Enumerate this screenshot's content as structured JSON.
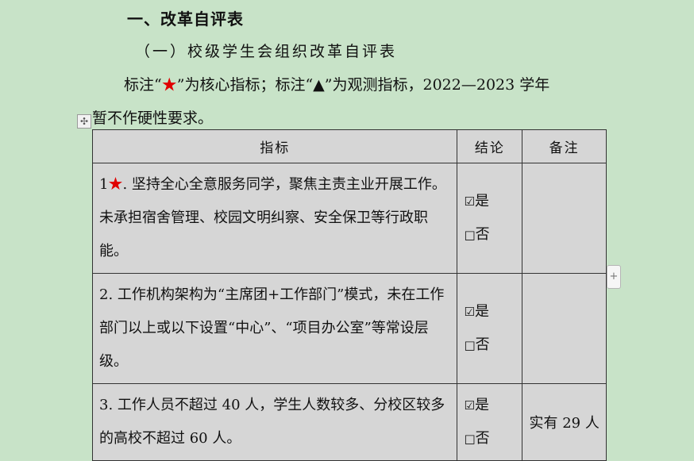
{
  "heading": "一、改革自评表",
  "subheading": "（一）校级学生会组织改革自评表",
  "note": {
    "prefix": "标注“",
    "star": "★",
    "mid": "”为核心指标；标注“",
    "triangle": "▲",
    "suffix": "”为观测指标，2022—2023 学年",
    "line2": "暂不作硬性要求。"
  },
  "icons": {
    "move": "move-cross-icon",
    "add": "plus-icon",
    "checked": "checked-box-icon",
    "unchecked": "empty-box-icon"
  },
  "colors": {
    "background": "#c8e3c8",
    "table_fill": "#d6d6d6",
    "star": "#e00000"
  },
  "table": {
    "headers": [
      "指标",
      "结论",
      "备注"
    ],
    "rows": [
      {
        "num": "1",
        "star": "★",
        "text": ". 坚持全心全意服务同学，聚焦主责主业开展工作。未承担宿舍管理、校园文明纠察、安全保卫等行政职能。",
        "yes_box": "☑",
        "yes": "是",
        "no_box": "□",
        "no": "否",
        "remark": ""
      },
      {
        "num": "2",
        "star": "",
        "text": ". 工作机构架构为“主席团+工作部门”模式，未在工作部门以上或以下设置“中心”、“项目办公室”等常设层级。",
        "yes_box": "☑",
        "yes": "是",
        "no_box": "□",
        "no": "否",
        "remark": ""
      },
      {
        "num": "3",
        "star": "",
        "text": ". 工作人员不超过 40 人，学生人数较多、分校区较多的高校不超过 60 人。",
        "yes_box": "☑",
        "yes": "是",
        "no_box": "□",
        "no": "否",
        "remark": "实有 29 人"
      }
    ]
  }
}
